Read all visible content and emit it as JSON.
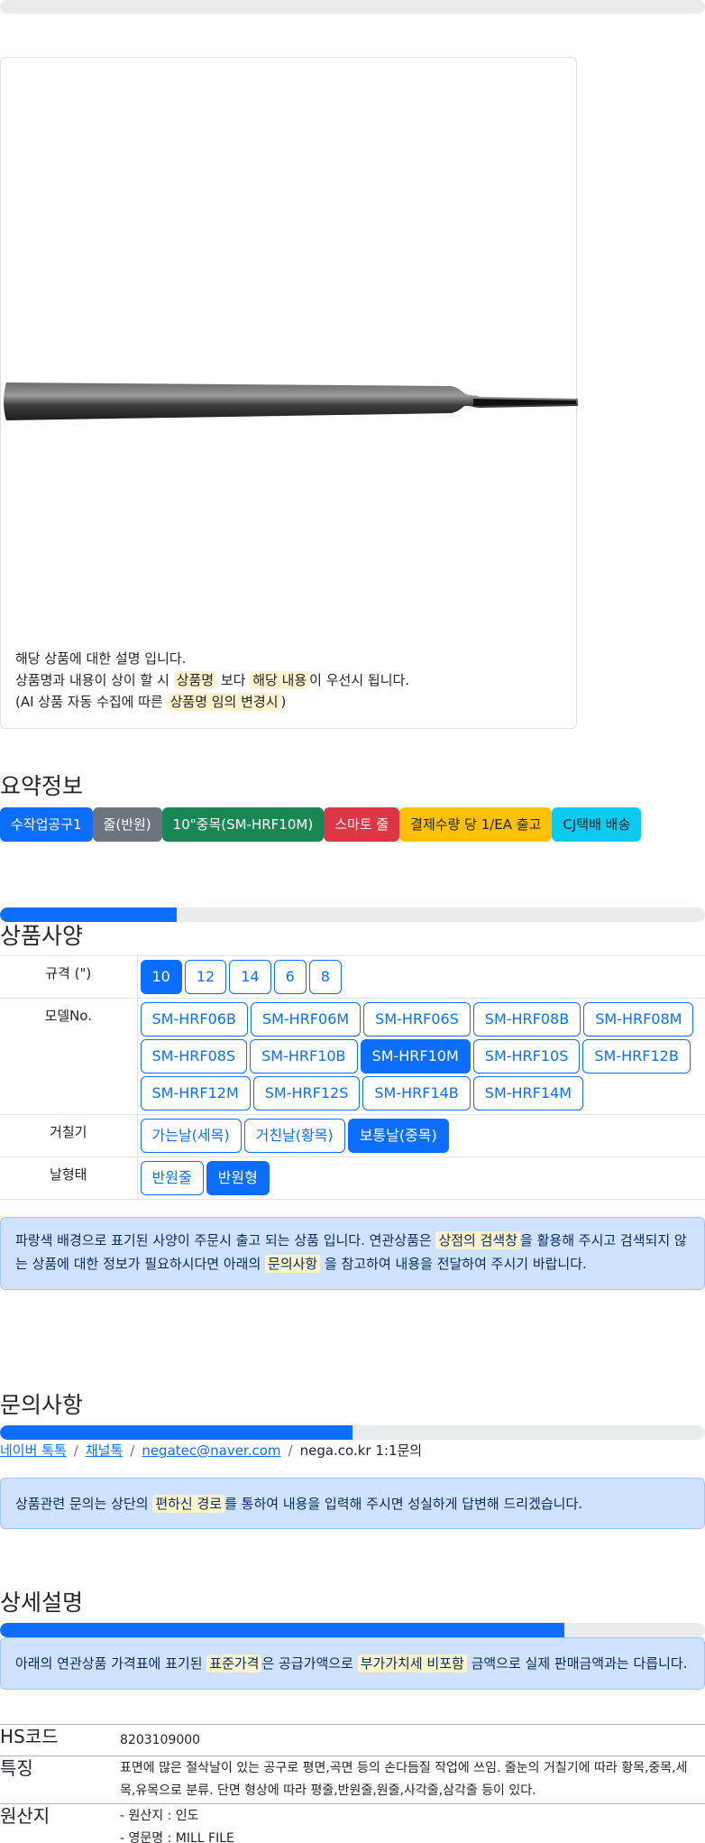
{
  "notice": {
    "line1": "해당 상품에 대한 설명 입니다.",
    "line2_a": "상품명과 내용이 상이 할 시 ",
    "line2_hl1": "상품명",
    "line2_b": " 보다 ",
    "line2_hl2": "해당 내용",
    "line2_c": "이 우선시 됩니다.",
    "line3_a": "(AI 상품 자동 수집에 따른 ",
    "line3_hl": "상품명 임의 변경시",
    "line3_b": ")"
  },
  "summary": {
    "title": "요약정보",
    "badges": [
      {
        "label": "수작업공구1",
        "color": "#0d6efd",
        "text": "#ffffff"
      },
      {
        "label": "줄(반원)",
        "color": "#6c757d",
        "text": "#ffffff"
      },
      {
        "label": "10\"중목(SM-HRF10M)",
        "color": "#198754",
        "text": "#ffffff"
      },
      {
        "label": "스마토 줄",
        "color": "#dc3545",
        "text": "#ffffff"
      },
      {
        "label": "결제수량 당 1/EA 출고",
        "color": "#ffc107",
        "text": "#212529"
      },
      {
        "label": "CJ택배 배송",
        "color": "#0dcaf0",
        "text": "#212529"
      }
    ]
  },
  "spec": {
    "title": "상품사양",
    "progress": 0.25,
    "rows": [
      {
        "label": "규격 (\")",
        "options": [
          "10",
          "12",
          "14",
          "6",
          "8"
        ],
        "selected": "10"
      },
      {
        "label": "모델No.",
        "options": [
          "SM-HRF06B",
          "SM-HRF06M",
          "SM-HRF06S",
          "SM-HRF08B",
          "SM-HRF08M",
          "SM-HRF08S",
          "SM-HRF10B",
          "SM-HRF10M",
          "SM-HRF10S",
          "SM-HRF12B",
          "SM-HRF12M",
          "SM-HRF12S",
          "SM-HRF14B",
          "SM-HRF14M"
        ],
        "selected": "SM-HRF10M"
      },
      {
        "label": "거칠기",
        "options": [
          "가는날(세목)",
          "거친날(황목)",
          "보통날(중목)"
        ],
        "selected": "보통날(중목)"
      },
      {
        "label": "날형태",
        "options": [
          "반원줄",
          "반원형"
        ],
        "selected": "반원형"
      }
    ],
    "info_a": "파랑색 배경으로 표기된 사양이 주문시 출고 되는 상품 입니다. 연관상품은 ",
    "info_hl1": "상점의 검색창",
    "info_b": "을 활용해 주시고 검색되지 않는 상품에 대한 정보가 필요하시다면 아래의 ",
    "info_hl2": "문의사항",
    "info_c": " 을 참고하여 내용을 전달하여 주시기 바랍니다."
  },
  "inquiry": {
    "title": "문의사항",
    "progress": 0.5,
    "links": [
      "네이버 톡톡",
      "채널톡",
      "negatec@naver.com"
    ],
    "current": "nega.co.kr 1:1문의",
    "info_a": "상품관련 문의는 상단의 ",
    "info_hl": "편하신 경로",
    "info_b": "를 통하여 내용을 입력해 주시면 성실하게 답변해 드리겠습니다."
  },
  "detail": {
    "title": "상세설명",
    "progress": 0.8,
    "info_a": "아래의 연관상품 가격표에 표기된 ",
    "info_hl1": "표준가격",
    "info_b": "은 공급가액으로 ",
    "info_hl2": "부가가치세 비포함",
    "info_c": " 금액으로 실제 판매금액과는 다릅니다.",
    "hs_label": "HS코드",
    "hs_value": "8203109000",
    "feature_label": "특징",
    "feature_value": "표면에 많은 절삭날이 있는 공구로 평면,곡면 등의 손다듬질 작업에 쓰임. 줄눈의 거칠기에 따라 황목,중목,세목,유목으로 분류. 단면 형상에 따라 평줄,반원줄,원줄,사각줄,삼각줄 등이 있다.",
    "origin_label": "원산지",
    "origin_line1": "- 원산지 : 인도",
    "origin_line2": "- 영문명 : MILL FILE"
  }
}
